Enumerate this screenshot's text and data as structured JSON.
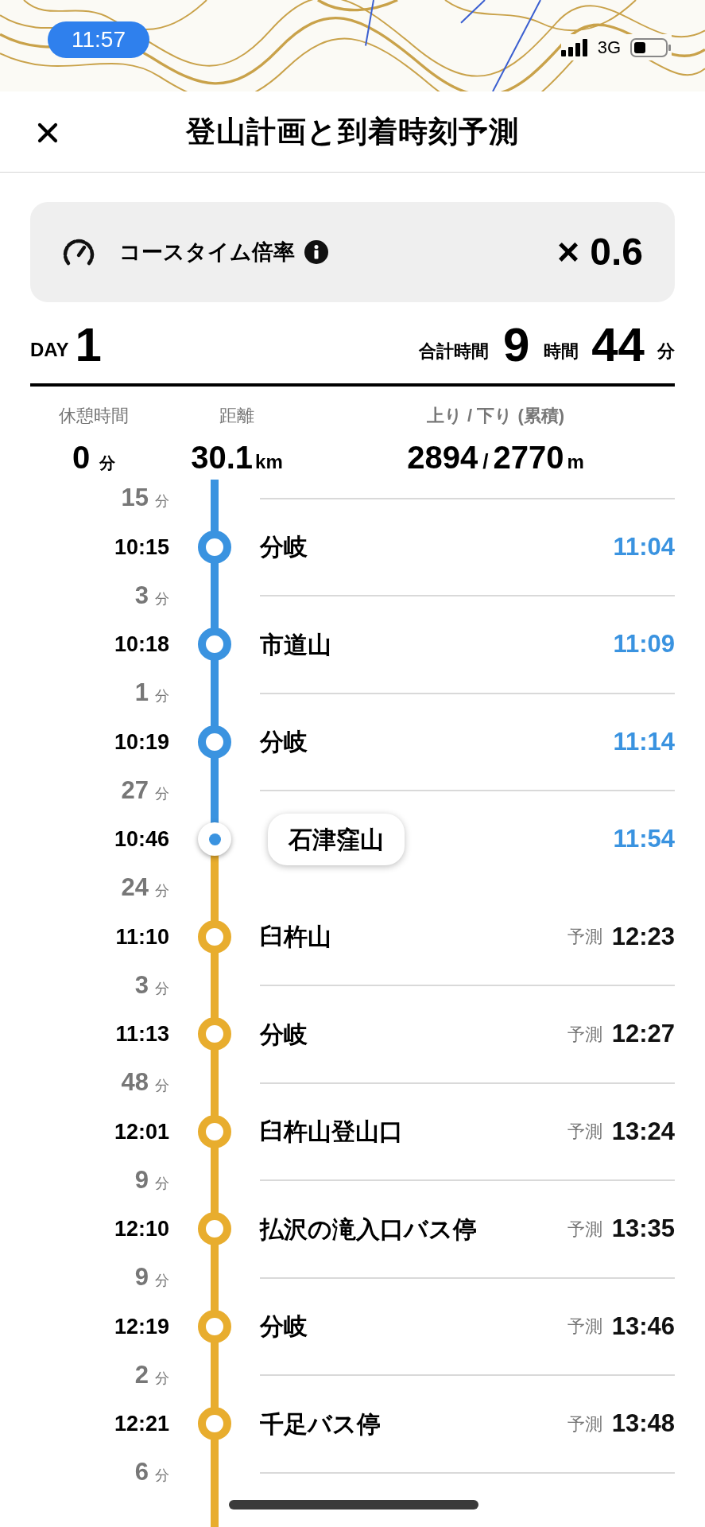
{
  "status_bar": {
    "time": "11:57",
    "network": "3G"
  },
  "header": {
    "title": "登山計画と到着時刻予測"
  },
  "course_time": {
    "label": "コースタイム倍率",
    "value": "× 0.6"
  },
  "day": {
    "label": "DAY",
    "number": "1",
    "total_label": "合計時間",
    "hours": "9",
    "hours_unit": "時間",
    "minutes": "44",
    "minutes_unit": "分"
  },
  "stats": {
    "rest": {
      "label": "休憩時間",
      "value": "0",
      "unit": "分"
    },
    "distance": {
      "label": "距離",
      "value": "30.1",
      "unit": "km"
    },
    "elevation": {
      "label": "上り / 下り (累積)",
      "up": "2894",
      "separator": "/",
      "down": "2770",
      "unit": "m"
    }
  },
  "timeline": [
    {
      "kind": "duration",
      "value": "15",
      "unit": "分"
    },
    {
      "kind": "waypoint",
      "time": "10:15",
      "name": "分岐",
      "passed": true,
      "current": false,
      "arrival": "11:04"
    },
    {
      "kind": "duration",
      "value": "3",
      "unit": "分"
    },
    {
      "kind": "waypoint",
      "time": "10:18",
      "name": "市道山",
      "passed": true,
      "current": false,
      "arrival": "11:09"
    },
    {
      "kind": "duration",
      "value": "1",
      "unit": "分"
    },
    {
      "kind": "waypoint",
      "time": "10:19",
      "name": "分岐",
      "passed": true,
      "current": false,
      "arrival": "11:14"
    },
    {
      "kind": "duration",
      "value": "27",
      "unit": "分"
    },
    {
      "kind": "waypoint",
      "time": "10:46",
      "name": "石津窪山",
      "passed": true,
      "current": true,
      "arrival": "11:54"
    },
    {
      "kind": "duration",
      "value": "24",
      "unit": "分"
    },
    {
      "kind": "waypoint",
      "time": "11:10",
      "name": "臼杵山",
      "passed": false,
      "current": false,
      "forecast_label": "予測",
      "arrival": "12:23"
    },
    {
      "kind": "duration",
      "value": "3",
      "unit": "分"
    },
    {
      "kind": "waypoint",
      "time": "11:13",
      "name": "分岐",
      "passed": false,
      "current": false,
      "forecast_label": "予測",
      "arrival": "12:27"
    },
    {
      "kind": "duration",
      "value": "48",
      "unit": "分"
    },
    {
      "kind": "waypoint",
      "time": "12:01",
      "name": "臼杵山登山口",
      "passed": false,
      "current": false,
      "forecast_label": "予測",
      "arrival": "13:24"
    },
    {
      "kind": "duration",
      "value": "9",
      "unit": "分"
    },
    {
      "kind": "waypoint",
      "time": "12:10",
      "name": "払沢の滝入口バス停",
      "passed": false,
      "current": false,
      "forecast_label": "予測",
      "arrival": "13:35"
    },
    {
      "kind": "duration",
      "value": "9",
      "unit": "分"
    },
    {
      "kind": "waypoint",
      "time": "12:19",
      "name": "分岐",
      "passed": false,
      "current": false,
      "forecast_label": "予測",
      "arrival": "13:46"
    },
    {
      "kind": "duration",
      "value": "2",
      "unit": "分"
    },
    {
      "kind": "waypoint",
      "time": "12:21",
      "name": "千足バス停",
      "passed": false,
      "current": false,
      "forecast_label": "予測",
      "arrival": "13:48"
    },
    {
      "kind": "duration",
      "value": "6",
      "unit": "分"
    }
  ]
}
